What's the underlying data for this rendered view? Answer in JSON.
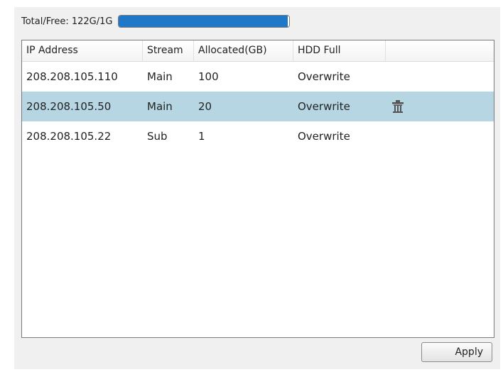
{
  "storage": {
    "label": "Total/Free:  122G/1G",
    "used_fraction": 0.99,
    "fill_color": "#1f77c8"
  },
  "table": {
    "headers": [
      "IP Address",
      "Stream",
      "Allocated(GB)",
      "HDD Full",
      ""
    ],
    "rows": [
      {
        "ip": "208.208.105.110",
        "stream": "Main",
        "allocated": "100",
        "hdd_full": "Overwrite",
        "selected": false
      },
      {
        "ip": "208.208.105.50",
        "stream": "Main",
        "allocated": "20",
        "hdd_full": "Overwrite",
        "selected": true,
        "action_icon": "trash-icon"
      },
      {
        "ip": "208.208.105.22",
        "stream": "Sub",
        "allocated": "1",
        "hdd_full": "Overwrite",
        "selected": false
      }
    ],
    "selected_row_color": "#b6d6e4"
  },
  "apply_label": "Apply"
}
